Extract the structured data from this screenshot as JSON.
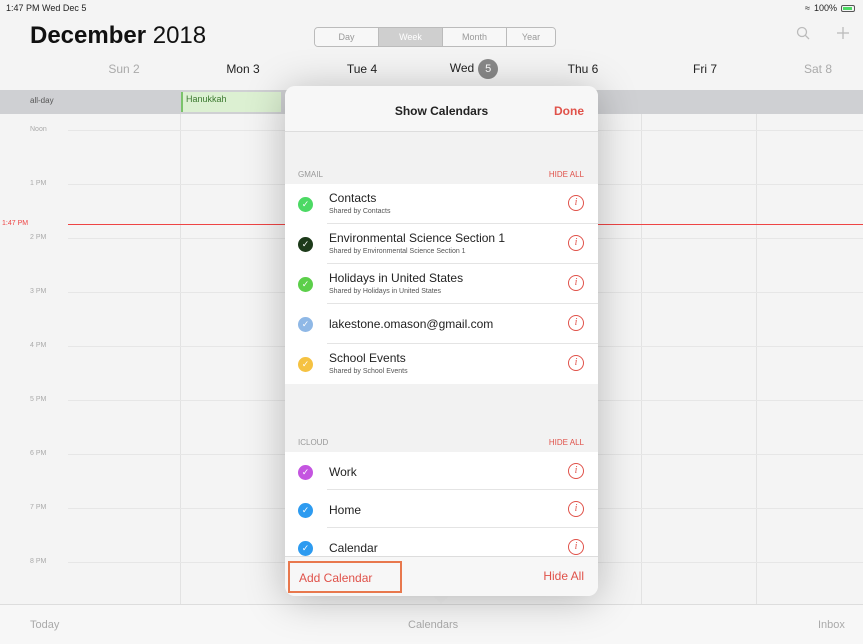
{
  "status_bar": {
    "time_date": "1:47 PM  Wed Dec 5",
    "battery": "100%"
  },
  "header": {
    "month": "December",
    "year": "2018",
    "segments": [
      "Day",
      "Week",
      "Month",
      "Year"
    ],
    "active_segment": "Week",
    "icons": [
      "search-icon",
      "plus-icon"
    ]
  },
  "week": {
    "days": [
      {
        "label": "Sun 2"
      },
      {
        "label": "Mon 3"
      },
      {
        "label": "Tue 4"
      },
      {
        "label": "Wed",
        "badge": "5"
      },
      {
        "label": "Thu 6"
      },
      {
        "label": "Fri 7"
      },
      {
        "label": "Sat 8"
      }
    ],
    "all_day_label": "all-day",
    "all_day_event": "Hanukkah",
    "hours": [
      "Noon",
      "1 PM",
      "2 PM",
      "3 PM",
      "4 PM",
      "5 PM",
      "6 PM",
      "7 PM",
      "8 PM"
    ],
    "now_label": "1:47 PM"
  },
  "popover": {
    "title": "Show Calendars",
    "done": "Done",
    "sections": [
      {
        "name": "GMAIL",
        "hide_all": "HIDE ALL",
        "calendars": [
          {
            "title": "Contacts",
            "subtitle": "Shared by Contacts",
            "color": "#4cd964"
          },
          {
            "title": "Environmental Science Section 1",
            "subtitle": "Shared by Environmental Science Section 1",
            "color": "#1d3a1a"
          },
          {
            "title": "Holidays in United States",
            "subtitle": "Shared by Holidays in United States",
            "color": "#5ccf4a"
          },
          {
            "title": "lakestone.omason@gmail.com",
            "subtitle": "",
            "color": "#8fb8e6"
          },
          {
            "title": "School Events",
            "subtitle": "Shared by School Events",
            "color": "#f5c242"
          }
        ]
      },
      {
        "name": "ICLOUD",
        "hide_all": "HIDE ALL",
        "calendars": [
          {
            "title": "Work",
            "subtitle": "",
            "color": "#c455e0"
          },
          {
            "title": "Home",
            "subtitle": "",
            "color": "#2d9bf0"
          },
          {
            "title": "Calendar",
            "subtitle": "",
            "color": "#2d9bf0"
          }
        ]
      }
    ],
    "add_calendar": "Add Calendar",
    "hide_all_footer": "Hide All"
  },
  "tabbar": {
    "today": "Today",
    "calendars": "Calendars",
    "inbox": "Inbox"
  },
  "colors": {
    "accent": "#e0524a",
    "now_line": "#ee4444",
    "event_green": "#dcf0d2"
  }
}
